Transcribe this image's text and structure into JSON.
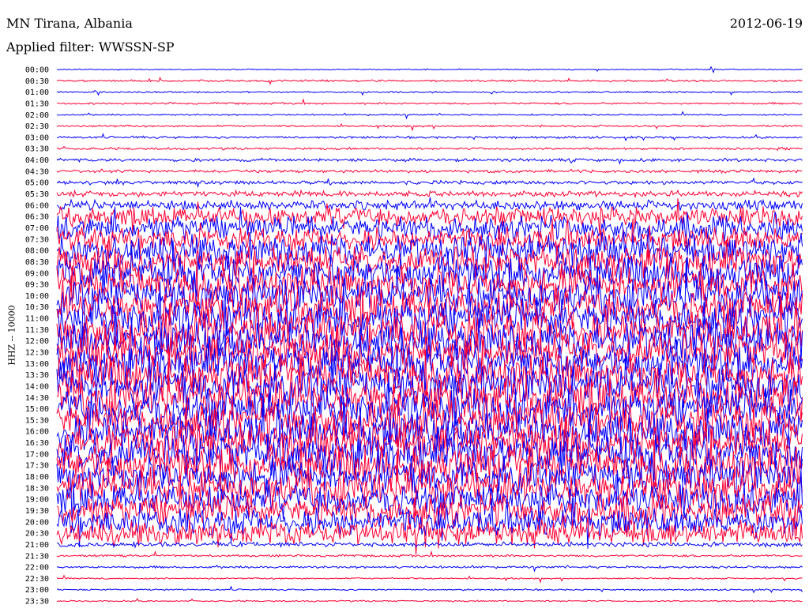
{
  "header": {
    "station": "MN Tirana, Albania",
    "filter": "Applied filter: WWSSN-SP",
    "date": "2012-06-19"
  },
  "chart_data": {
    "type": "line",
    "title": "MN Tirana, Albania",
    "subtitle": "Applied filter: WWSSN-SP",
    "ylabel": "HHZ -- 10000",
    "xlabel": "",
    "colors": [
      "#0000ff",
      "#ff0033"
    ],
    "row_labels": [
      "00:00",
      "00:30",
      "01:00",
      "01:30",
      "02:00",
      "02:30",
      "03:00",
      "03:30",
      "04:00",
      "04:30",
      "05:00",
      "05:30",
      "06:00",
      "06:30",
      "07:00",
      "07:30",
      "08:00",
      "08:30",
      "09:00",
      "09:30",
      "10:00",
      "10:30",
      "11:00",
      "11:30",
      "12:00",
      "12:30",
      "13:00",
      "13:30",
      "14:00",
      "14:30",
      "15:00",
      "15:30",
      "16:00",
      "16:30",
      "17:00",
      "17:30",
      "18:00",
      "18:30",
      "19:00",
      "19:30",
      "20:00",
      "20:30",
      "21:00",
      "21:30",
      "22:00",
      "22:30",
      "23:00",
      "23:30"
    ],
    "relative_amplitude": [
      0.3,
      0.5,
      0.4,
      0.5,
      0.4,
      0.5,
      0.6,
      0.6,
      0.8,
      0.8,
      1.0,
      1.5,
      2.5,
      5,
      6,
      6,
      8,
      8,
      9,
      9,
      9,
      9,
      10,
      10,
      10,
      10,
      10,
      10,
      10,
      10,
      10,
      10,
      10,
      10,
      10,
      10,
      9,
      9,
      8,
      8,
      7,
      6,
      1.2,
      0.6,
      0.6,
      0.4,
      0.4,
      0.4
    ]
  }
}
